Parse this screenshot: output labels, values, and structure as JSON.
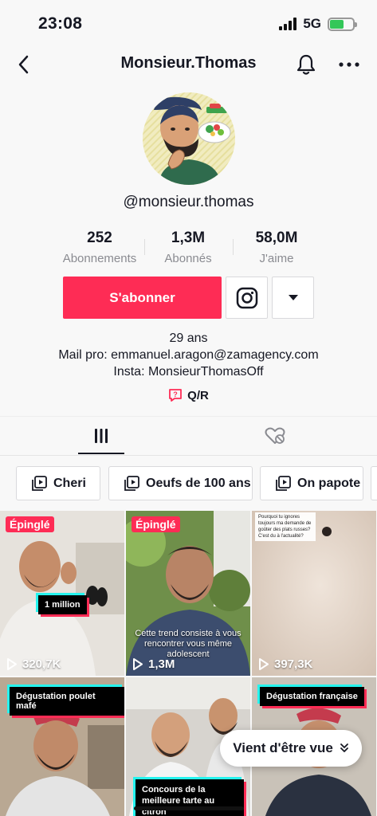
{
  "status": {
    "time": "23:08",
    "network": "5G",
    "battery_level": 0.6
  },
  "nav": {
    "title": "Monsieur.Thomas",
    "back_icon": "chevron-left-icon",
    "bell_icon": "bell-icon",
    "more_icon": "more-horizontal-icon"
  },
  "profile": {
    "handle": "@monsieur.thomas",
    "stats": [
      {
        "value": "252",
        "label": "Abonnements"
      },
      {
        "value": "1,3M",
        "label": "Abonnés"
      },
      {
        "value": "58,0M",
        "label": "J'aime"
      }
    ],
    "follow_label": "S'abonner",
    "bio_lines": [
      "29 ans",
      "Mail pro: emmanuel.aragon@zamagency.com",
      "Insta: MonsieurThomasOff"
    ],
    "qr_label": "Q/R"
  },
  "tabs": [
    "videos-grid-icon",
    "liked-hidden-icon"
  ],
  "playlists": [
    {
      "label": "Cheri"
    },
    {
      "label": "Oeufs de 100 ans"
    },
    {
      "label": "On papote"
    }
  ],
  "videos": [
    {
      "pinned": "Épinglé",
      "views": "320,7K",
      "caption": "1 million"
    },
    {
      "pinned": "Épinglé",
      "views": "1,3M",
      "caption": "Cette trend consiste à vous rencontrer vous même adolescent"
    },
    {
      "views": "397,3K",
      "caption": "Pourquoi tu ignores toujours ma demande de goûter des plats russes? C'est du à l'actualité?"
    },
    {
      "caption": "Dégustation poulet mafé"
    },
    {
      "caption": "Concours de la meilleure tarte au citron"
    },
    {
      "caption": "Dégustation française"
    }
  ],
  "pill": {
    "label": "Vient d'être vue"
  },
  "colors": {
    "accent": "#fe2c55",
    "cyan": "#25f4ee"
  }
}
